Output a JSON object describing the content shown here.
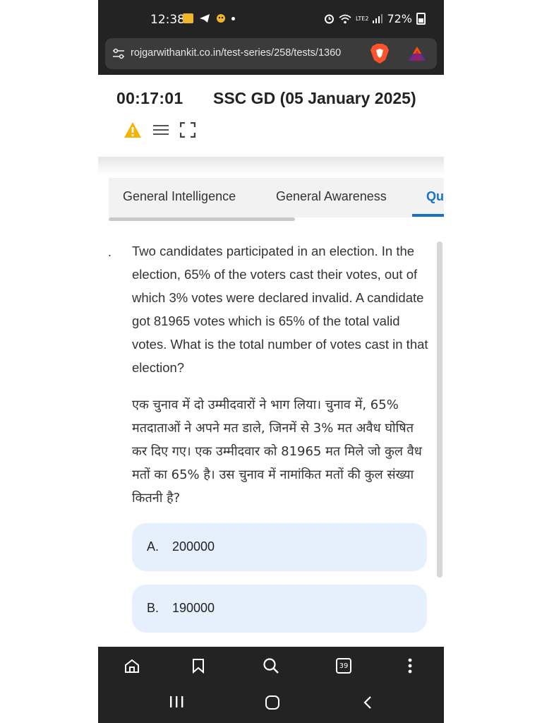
{
  "status_bar": {
    "time": "12:38",
    "battery": "72%",
    "signal_label": "LTE2"
  },
  "browser": {
    "url": "rojgarwithankit.co.in/test-series/258/tests/1360"
  },
  "test": {
    "timer": "00:17:01",
    "title": "SSC GD (05 January 2025)"
  },
  "tabs": [
    {
      "label": "General Intelligence"
    },
    {
      "label": "General Awareness"
    },
    {
      "label": "Qu"
    }
  ],
  "question": {
    "bullet": ".",
    "english": "Two candidates participated in an election. In the election, 65% of the voters cast their votes, out of which 3% votes were declared invalid. A candidate got 81965 votes which is 65% of the total valid votes. What is the total number of votes cast in that election?",
    "hindi": "एक चुनाव में दो उम्मीदवारों ने भाग लिया। चुनाव में, 65% मतदाताओं ने अपने मत डाले, जिनमें से 3% मत अवैध घोषित कर दिए गए। एक उम्मीदवार को 81965 मत मिले जो कुल वैध मतों का 65% है। उस चुनाव में नामांकित मतों की कुल संख्या कितनी है?"
  },
  "options": [
    {
      "letter": "A.",
      "value": "200000"
    },
    {
      "letter": "B.",
      "value": "190000"
    }
  ],
  "browser_nav": {
    "tabs_count": "39"
  },
  "colors": {
    "accent": "#1a6fc9",
    "option_bg": "#e6f0fc",
    "warning": "#f5b400",
    "dark_bar": "#232323"
  }
}
